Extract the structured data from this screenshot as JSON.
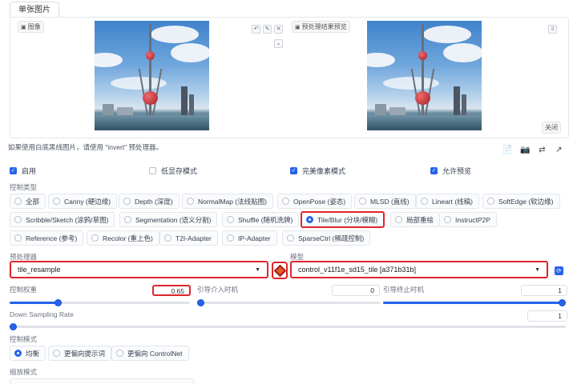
{
  "tab": {
    "single_image": "单张图片"
  },
  "input_panel": {
    "image_label": "图像",
    "preview_label": "预处理结果预览",
    "close_label": "关闭"
  },
  "hint_text": "如果使用白底黑线图片，请使用 \"invert\" 预处理器。",
  "checkboxes": [
    {
      "label": "启用",
      "checked": true
    },
    {
      "label": "低显存模式",
      "checked": false
    },
    {
      "label": "完美像素模式",
      "checked": true
    },
    {
      "label": "允许预览",
      "checked": true
    }
  ],
  "control_type": {
    "label": "控制类型",
    "selected": "Tile/Blur (分块/模糊)",
    "options": [
      "全部",
      "Canny (硬边缘)",
      "Depth (深度)",
      "NormalMap (法线贴图)",
      "OpenPose (姿态)",
      "MLSD (直线)",
      "Lineart (线稿)",
      "SoftEdge (软边缘)",
      "Scribble/Sketch (涂鸦/草图)",
      "Segmentation (语义分割)",
      "Shuffle (随机洗牌)",
      "Tile/Blur (分块/模糊)",
      "局部重绘",
      "InstructP2P",
      "Reference (参考)",
      "Recolor (重上色)",
      "T2I-Adapter",
      "IP-Adapter",
      "SparseCtrl (稀疏控制)"
    ]
  },
  "preprocessor": {
    "label": "预处理器",
    "value": "tile_resample"
  },
  "model": {
    "label": "模型",
    "value": "control_v11f1e_sd15_tile [a371b31b]"
  },
  "control_weight": {
    "label": "控制权重",
    "value": "0.65",
    "fraction": 0.26
  },
  "start_step": {
    "label": "引导介入时机",
    "value": "0",
    "fraction": 0.0
  },
  "end_step": {
    "label": "引导终止时机",
    "value": "1",
    "fraction": 1.0
  },
  "down_sampling": {
    "label": "Down Sampling Rate",
    "value": "1",
    "fraction": 0.0
  },
  "control_mode": {
    "label": "控制模式",
    "options": [
      "均衡",
      "更偏向提示词",
      "更偏向 ControlNet"
    ],
    "selected": "均衡"
  },
  "resize_mode": {
    "label": "缩放模式"
  },
  "accent_color": "#2563eb",
  "highlight_color": "#e0242b"
}
